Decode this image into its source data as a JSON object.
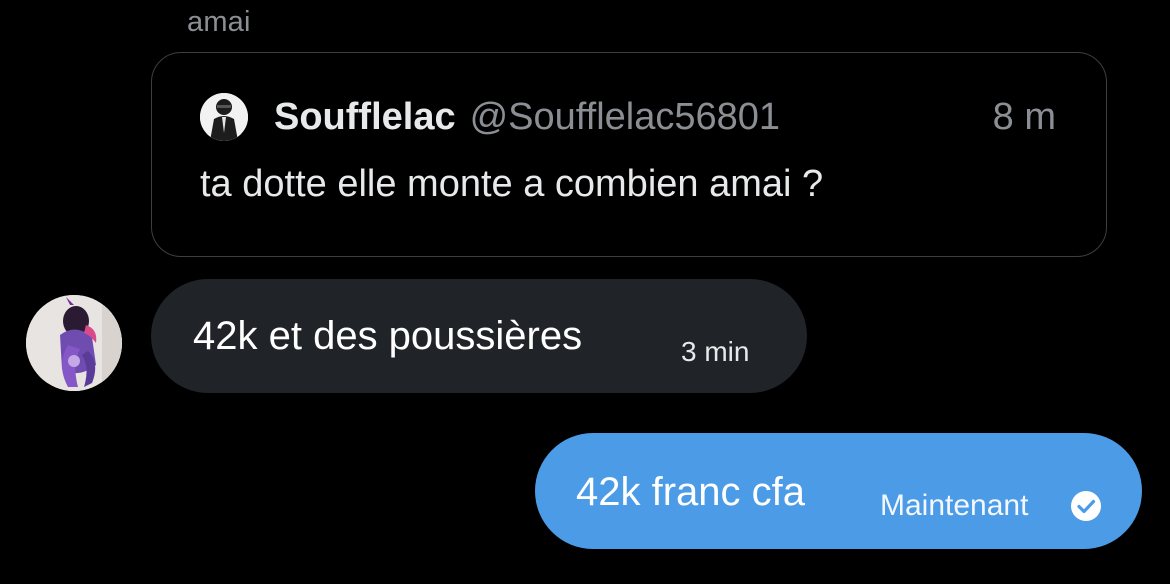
{
  "conversation": {
    "sender_name": "amai"
  },
  "quoted_post": {
    "author_name": "Soufflelac",
    "author_handle": "@Soufflelac56801",
    "time": "8 m",
    "text": "ta dotte elle monte a combien amai ?",
    "avatar_icon": "profile-photo"
  },
  "received_message": {
    "text": "42k et des poussières",
    "time": "3 min",
    "avatar_icon": "profile-photo"
  },
  "sent_message": {
    "text": "42k franc cfa",
    "time": "Maintenant",
    "status_icon": "read-check-icon"
  },
  "colors": {
    "background": "#000000",
    "sent_bubble": "#4c9be7",
    "received_bubble": "#202327",
    "secondary_text": "#8b8f94",
    "card_border": "#3b3e42"
  }
}
